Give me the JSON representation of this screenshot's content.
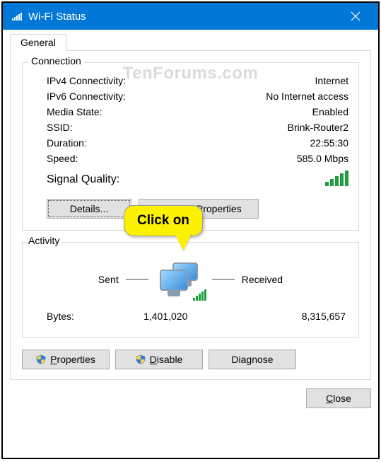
{
  "window": {
    "title": "Wi-Fi Status",
    "close_icon": "close-icon"
  },
  "tabs": {
    "general": "General"
  },
  "watermark": "TenForums.com",
  "connection": {
    "group_label": "Connection",
    "ipv4_label": "IPv4 Connectivity:",
    "ipv4_value": "Internet",
    "ipv6_label": "IPv6 Connectivity:",
    "ipv6_value": "No Internet access",
    "media_label": "Media State:",
    "media_value": "Enabled",
    "ssid_label": "SSID:",
    "ssid_value": "Brink-Router2",
    "duration_label": "Duration:",
    "duration_value": "22:55:30",
    "speed_label": "Speed:",
    "speed_value": "585.0 Mbps",
    "signal_label": "Signal Quality:",
    "details_btn": "Details...",
    "wireless_btn_pre": "W",
    "wireless_btn_post": "ireless Properties"
  },
  "callout": {
    "text": "Click on"
  },
  "activity": {
    "group_label": "Activity",
    "sent_label": "Sent",
    "received_label": "Received",
    "bytes_label": "Bytes:",
    "bytes_sent": "1,401,020",
    "bytes_received": "8,315,657"
  },
  "buttons": {
    "properties": "Properties",
    "disable": "Disable",
    "diagnose": "Diagnose",
    "close": "Close"
  }
}
